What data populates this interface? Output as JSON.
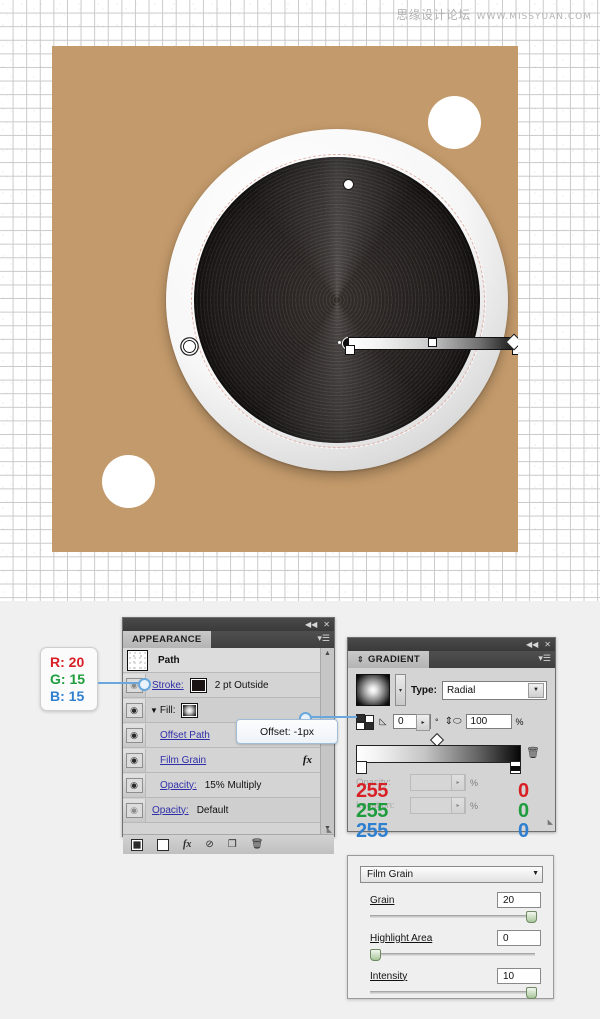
{
  "watermark": {
    "cn": "思缘设计论坛",
    "url": "WWW.MISSYUAN.COM"
  },
  "artboard": {
    "background_color": "#c39a6b",
    "disc_color": "#211d1c",
    "ring_color": "#f4f4f4",
    "deco_circle_color": "#ffffff",
    "gradient_annotator": {
      "type": "radial",
      "from_color": "#ffffff",
      "to_color": "#000000"
    }
  },
  "rgb_callout": {
    "r_label": "R: 20",
    "g_label": "G: 15",
    "b_label": "B: 15",
    "r_color": "#d81f26",
    "g_color": "#1f9c3e",
    "b_color": "#2f7fd0"
  },
  "offset_callout": {
    "text": "Offset: -1px"
  },
  "appearance_panel": {
    "tab_label": "APPEARANCE",
    "rows": [
      {
        "icon": "path-thumbnail",
        "label": "Path",
        "value": "",
        "type": "header"
      },
      {
        "icon": "eye-icon",
        "label": "Stroke:",
        "swatch": "solid",
        "value": "2 pt  Outside",
        "type": "stroke"
      },
      {
        "icon": "eye-icon",
        "label": "Fill:",
        "swatch": "gradient",
        "value": "",
        "type": "fill"
      },
      {
        "icon": "eye-icon",
        "label": "Offset Path",
        "value": "",
        "type": "effect"
      },
      {
        "icon": "eye-icon",
        "label": "Film Grain",
        "value": "",
        "badge": "fx",
        "type": "effect"
      },
      {
        "icon": "eye-icon",
        "label": "Opacity:",
        "value": "15% Multiply",
        "type": "opacity"
      },
      {
        "icon": "eye-icon",
        "label": "Opacity:",
        "value": "Default",
        "type": "opacity"
      }
    ],
    "footer_icons": [
      "add-new-stroke-icon",
      "add-new-fill-icon",
      "add-new-effect-icon",
      "clear-appearance-icon",
      "duplicate-item-icon",
      "delete-item-icon"
    ],
    "fx_badge": "fx"
  },
  "gradient_panel": {
    "tab_label": "GRADIENT",
    "type_label": "Type:",
    "type_value": "Radial",
    "angle_value": "0",
    "angle_unit": "°",
    "aspect_value": "100",
    "aspect_unit": "%",
    "opacity_label": "Opacity:",
    "opacity_unit": "%",
    "location_label": "Location:",
    "location_unit": "%",
    "left_stop": {
      "r": "255",
      "g": "255",
      "b": "255",
      "color": "#ffffff"
    },
    "right_stop": {
      "r": "0",
      "g": "0",
      "b": "0",
      "color": "#000000"
    }
  },
  "film_grain_dialog": {
    "effect_name": "Film Grain",
    "controls": [
      {
        "label": "Grain",
        "value": "20",
        "knob_percent": 100
      },
      {
        "label": "Highlight Area",
        "value": "0",
        "knob_percent": 0
      },
      {
        "label": "Intensity",
        "value": "10",
        "knob_percent": 100
      }
    ]
  }
}
